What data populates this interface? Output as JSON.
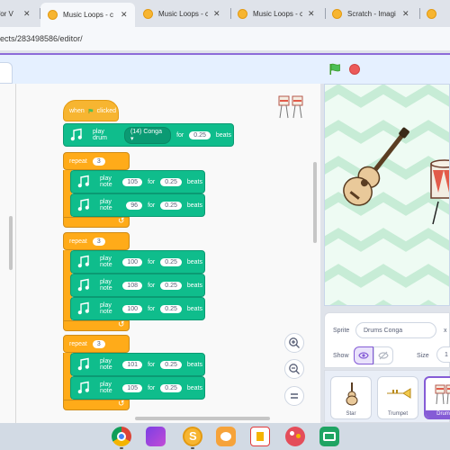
{
  "browser": {
    "tabs": [
      {
        "title": "for V"
      },
      {
        "title": "Music Loops - c",
        "active": true
      },
      {
        "title": "Music Loops - c"
      },
      {
        "title": "Music Loops - c"
      },
      {
        "title": "Scratch - Imagi"
      },
      {
        "title": ""
      }
    ],
    "url": "ects/283498586/editor/"
  },
  "script": {
    "hat_when": "when",
    "hat_clicked": "clicked",
    "play_drum": "play drum",
    "drum_value": "(14) Conga",
    "for": "for",
    "beats": "beats",
    "drum_beats": "0.25",
    "repeat": "repeat",
    "play_note": "play note",
    "loops": [
      {
        "count": "3",
        "notes": [
          {
            "note": "105",
            "beats": "0.25"
          },
          {
            "note": "96",
            "beats": "0.25"
          }
        ]
      },
      {
        "count": "3",
        "notes": [
          {
            "note": "100",
            "beats": "0.25"
          },
          {
            "note": "108",
            "beats": "0.25"
          },
          {
            "note": "100",
            "beats": "0.25"
          }
        ]
      },
      {
        "count": "3",
        "notes": [
          {
            "note": "101",
            "beats": "0.25"
          },
          {
            "note": "105",
            "beats": "0.25"
          }
        ]
      }
    ]
  },
  "sprite_info": {
    "sprite_label": "Sprite",
    "sprite_name": "Drums Conga",
    "x_label": "x",
    "show_label": "Show",
    "size_label": "Size",
    "size_value": "1"
  },
  "sprites": [
    {
      "name": "Star"
    },
    {
      "name": "Trumpet"
    },
    {
      "name": "Drums",
      "selected": true
    }
  ],
  "icons": {
    "green_flag": "green-flag-icon",
    "stop": "stop-icon",
    "zoom_in": "zoom-in-icon",
    "zoom_out": "zoom-out-icon",
    "zoom_reset": "zoom-reset-icon"
  },
  "colors": {
    "events": "#ffbf00",
    "control": "#ffab19",
    "music": "#0fbd8c",
    "accent": "#855cd6"
  }
}
